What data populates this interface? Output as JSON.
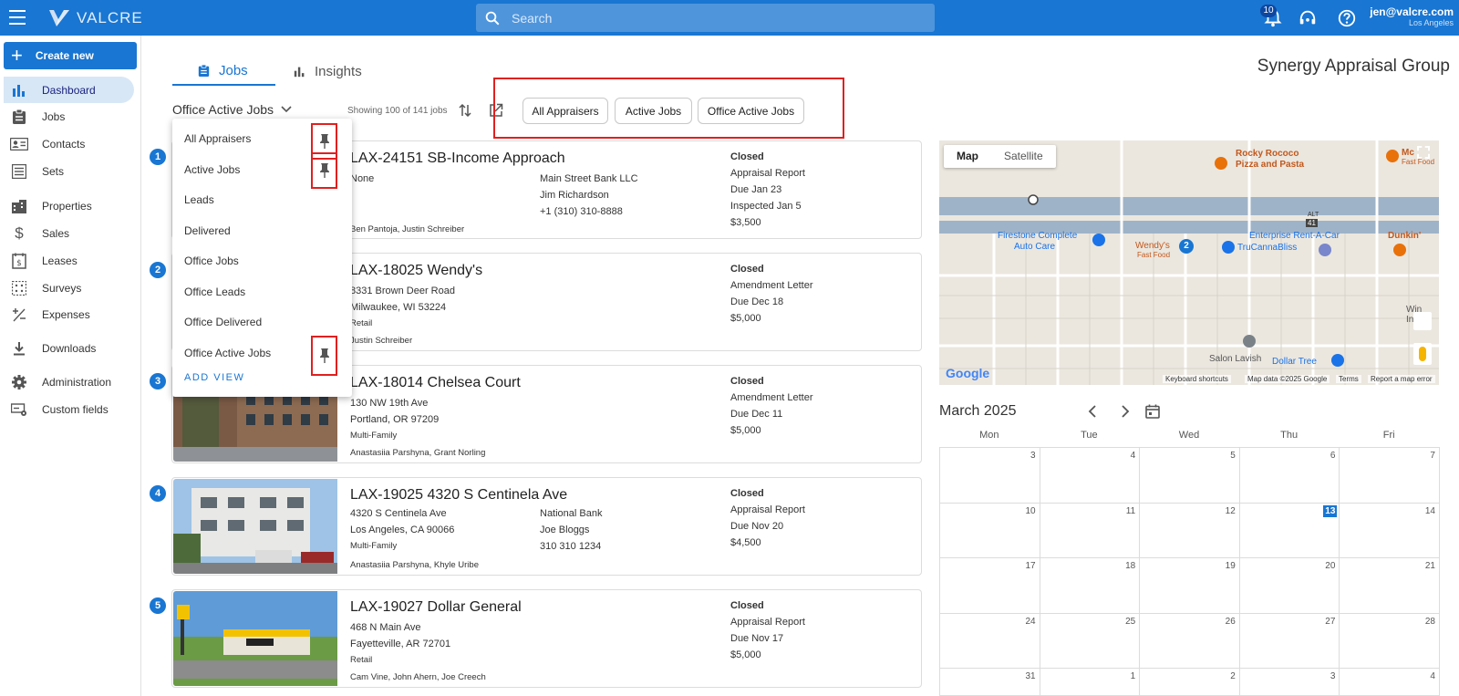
{
  "topbar": {
    "logo_text": "VALCRE",
    "search_placeholder": "Search",
    "notification_count": "10",
    "user_email": "jen@valcre.com",
    "user_location": "Los Angeles"
  },
  "sidebar": {
    "create_label": "Create new",
    "items": [
      {
        "label": "Dashboard",
        "icon": "bar-chart-icon"
      },
      {
        "label": "Jobs",
        "icon": "clipboard-icon"
      },
      {
        "label": "Contacts",
        "icon": "contact-card-icon"
      },
      {
        "label": "Sets",
        "icon": "list-icon"
      },
      {
        "label": "Properties",
        "icon": "building-icon"
      },
      {
        "label": "Sales",
        "icon": "dollar-icon"
      },
      {
        "label": "Leases",
        "icon": "lease-doc-icon"
      },
      {
        "label": "Surveys",
        "icon": "survey-grid-icon"
      },
      {
        "label": "Expenses",
        "icon": "plus-minus-icon"
      },
      {
        "label": "Downloads",
        "icon": "download-icon"
      },
      {
        "label": "Administration",
        "icon": "gear-icon"
      },
      {
        "label": "Custom fields",
        "icon": "custom-fields-icon"
      }
    ]
  },
  "tabs": {
    "jobs": "Jobs",
    "insights": "Insights"
  },
  "company_name": "Synergy Appraisal Group",
  "view": {
    "selected": "Office Active Jobs",
    "showing": "Showing 100 of 141 jobs"
  },
  "chips": [
    "All Appraisers",
    "Active Jobs",
    "Office Active Jobs"
  ],
  "dropdown": {
    "items": [
      "All Appraisers",
      "Active Jobs",
      "Leads",
      "Delivered",
      "Office Jobs",
      "Office Leads",
      "Office Delivered",
      "Office Active Jobs"
    ],
    "add_view": "ADD VIEW"
  },
  "jobs": [
    {
      "num": "1",
      "title": "LAX-24151 SB-Income Approach",
      "addr1": "None",
      "addr2": "",
      "type": "",
      "people": "Ben Pantoja, Justin Schreiber",
      "client": "Main Street Bank LLC",
      "contact": "Jim Richardson",
      "phone": "+1 (310) 310-8888",
      "status": "Closed",
      "report": "Appraisal Report",
      "due": "Due Jan 23",
      "extra": "Inspected Jan 5",
      "fee": "$3,500"
    },
    {
      "num": "2",
      "title": "LAX-18025 Wendy's",
      "addr1": "8331 Brown Deer Road",
      "addr2": "Milwaukee, WI 53224",
      "type": "Retail",
      "people": "Justin Schreiber",
      "client": "",
      "contact": "",
      "phone": "",
      "status": "Closed",
      "report": "Amendment Letter",
      "due": "Due Dec 18",
      "extra": "$5,000",
      "fee": ""
    },
    {
      "num": "3",
      "title": "LAX-18014 Chelsea Court",
      "addr1": "130 NW 19th Ave",
      "addr2": "Portland, OR 97209",
      "type": "Multi-Family",
      "people": "Anastasiia Parshyna, Grant Norling",
      "client": "",
      "contact": "",
      "phone": "",
      "status": "Closed",
      "report": "Amendment Letter",
      "due": "Due Dec 11",
      "extra": "$5,000",
      "fee": ""
    },
    {
      "num": "4",
      "title": "LAX-19025 4320 S Centinela Ave",
      "addr1": "4320 S Centinela Ave",
      "addr2": "Los Angeles, CA 90066",
      "type": "Multi-Family",
      "people": "Anastasiia Parshyna, Khyle Uribe",
      "client": "National Bank",
      "contact": "Joe Bloggs",
      "phone": "310 310 1234",
      "status": "Closed",
      "report": "Appraisal Report",
      "due": "Due Nov 20",
      "extra": "$4,500",
      "fee": ""
    },
    {
      "num": "5",
      "title": "LAX-19027 Dollar General",
      "addr1": "468 N Main Ave",
      "addr2": "Fayetteville, AR 72701",
      "type": "Retail",
      "people": "Cam Vine, John Ahern, Joe Creech",
      "client": "",
      "contact": "",
      "phone": "",
      "status": "Closed",
      "report": "Appraisal Report",
      "due": "Due Nov 17",
      "extra": "$5,000",
      "fee": ""
    }
  ],
  "map": {
    "map_btn": "Map",
    "satellite_btn": "Satellite",
    "labels": {
      "rocky": "Rocky Rococo",
      "rocky2": "Pizza and Pasta",
      "mc": "Mc",
      "fastfood1": "Fast Food",
      "firestone": "Firestone Complete",
      "firestone2": "Auto Care",
      "wendys": "Wendy's",
      "fastfood2": "Fast Food",
      "enterprise": "Enterprise Rent-A-Car",
      "trucanna": "TruCannaBliss",
      "dunkin": "Dunkin'",
      "salon": "Salon Lavish",
      "dollar": "Dollar Tree",
      "win": "Win",
      "inte": "Inte",
      "route": "41",
      "route_alt": "ALT",
      "marker": "2"
    },
    "google": "Google",
    "shortcuts": "Keyboard shortcuts",
    "mapdata": "Map data ©2025 Google",
    "terms": "Terms",
    "report": "Report a map error"
  },
  "calendar": {
    "title": "March 2025",
    "weekdays": [
      "Mon",
      "Tue",
      "Wed",
      "Thu",
      "Fri"
    ],
    "weeks": [
      [
        "3",
        "4",
        "5",
        "6",
        "7"
      ],
      [
        "10",
        "11",
        "12",
        "13",
        "14"
      ],
      [
        "17",
        "18",
        "19",
        "20",
        "21"
      ],
      [
        "24",
        "25",
        "26",
        "27",
        "28"
      ],
      [
        "31",
        "1",
        "2",
        "3",
        "4"
      ]
    ],
    "today": "13"
  },
  "colors": {
    "brand": "#1976d2",
    "highlight": "#e02020"
  }
}
